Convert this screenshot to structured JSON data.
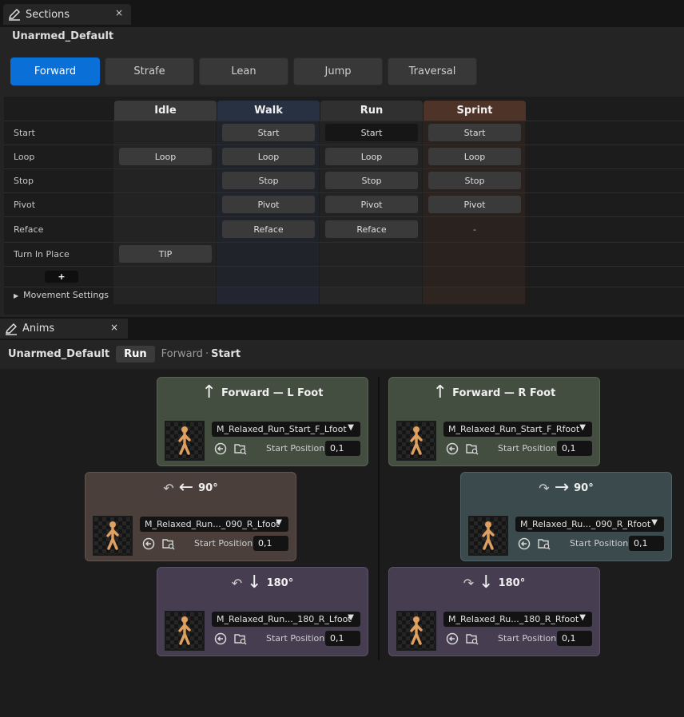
{
  "sections_panel": {
    "tab_label": "Sections",
    "close_glyph": "×",
    "title": "Unarmed_Default",
    "segments": [
      {
        "label": "Forward",
        "active": true
      },
      {
        "label": "Strafe",
        "active": false
      },
      {
        "label": "Lean",
        "active": false
      },
      {
        "label": "Jump",
        "active": false
      },
      {
        "label": "Traversal",
        "active": false
      }
    ],
    "columns": [
      {
        "label": "Idle",
        "color": "#3a3a3a"
      },
      {
        "label": "Walk",
        "color": "#283141"
      },
      {
        "label": "Run",
        "color": "#303030"
      },
      {
        "label": "Sprint",
        "color": "#4e3328"
      }
    ],
    "rows": [
      {
        "label": "Start",
        "cells": [
          "",
          "Start",
          "Start",
          "Start"
        ]
      },
      {
        "label": "Loop",
        "cells": [
          "Loop",
          "Loop",
          "Loop",
          "Loop"
        ]
      },
      {
        "label": "Stop",
        "cells": [
          "",
          "Stop",
          "Stop",
          "Stop"
        ]
      },
      {
        "label": "Pivot",
        "cells": [
          "",
          "Pivot",
          "Pivot",
          "Pivot"
        ]
      },
      {
        "label": "Reface",
        "cells": [
          "",
          "Reface",
          "Reface",
          "-"
        ]
      },
      {
        "label": "Turn In Place",
        "cells": [
          "TIP",
          "",
          "",
          ""
        ]
      }
    ],
    "add_row_label": "+",
    "movement_settings_label": "Movement Settings"
  },
  "anims_panel": {
    "tab_label": "Anims",
    "close_glyph": "×",
    "breadcrumb": {
      "set": "Unarmed_Default",
      "gait": "Run",
      "section": "Forward",
      "separator": "·",
      "item": "Start"
    },
    "start_position_label": "Start Position",
    "cards": [
      {
        "title": "Forward — L Foot",
        "arrow": "↑",
        "curl": "",
        "anim": "M_Relaxed_Run_Start_F_Lfoot",
        "start_position": "0,1",
        "color": "green"
      },
      {
        "title": "Forward — R Foot",
        "arrow": "↑",
        "curl": "",
        "anim": "M_Relaxed_Run_Start_F_Rfoot",
        "start_position": "0,1",
        "color": "green"
      },
      {
        "title": "90°",
        "arrow": "←",
        "curl": "↶",
        "anim": "M_Relaxed_Run..._090_R_Lfoot",
        "start_position": "0,1",
        "color": "brown"
      },
      {
        "title": "90°",
        "arrow": "→",
        "curl": "↷",
        "anim": "M_Relaxed_Ru..._090_R_Rfoot",
        "start_position": "0,1",
        "color": "slate"
      },
      {
        "title": "180°",
        "arrow": "↓",
        "curl": "↶",
        "anim": "M_Relaxed_Run..._180_R_Lfoot",
        "start_position": "0,1",
        "color": "purple"
      },
      {
        "title": "180°",
        "arrow": "↓",
        "curl": "↷",
        "anim": "M_Relaxed_Ru..._180_R_Rfoot",
        "start_position": "0,1",
        "color": "purple"
      }
    ]
  }
}
